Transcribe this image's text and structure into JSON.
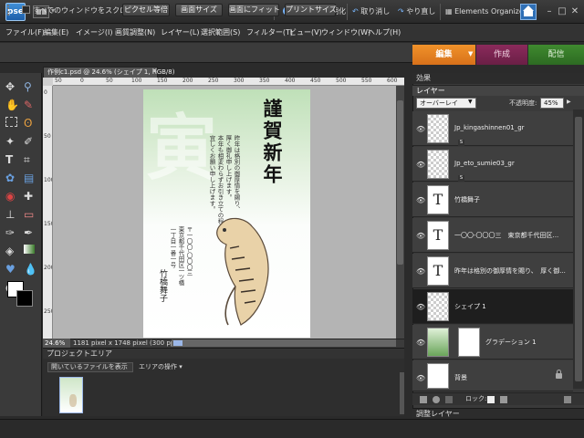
{
  "app": {
    "logo_text": "pse",
    "reset_panels": "パネルを初期化",
    "undo": "取り消し",
    "redo": "やり直し",
    "organizer": "Elements Organizer"
  },
  "menu": [
    "ファイル(F)",
    "編集(E)",
    "イメージ(I)",
    "画質調整(N)",
    "レイヤー(L)",
    "選択範囲(S)",
    "フィルター(T)",
    "ビュー(V)",
    "ウィンドウ(W)",
    "ヘルプ(H)"
  ],
  "options": {
    "scroll_all_label": "すべてのウィンドウをスクロール",
    "actual_pixels": "ピクセル等倍",
    "fit_screen": "画面サイズ",
    "fill_screen": "画面にフィット",
    "print_size": "プリントサイズ"
  },
  "mode_tabs": {
    "edit": "編集",
    "create": "作成",
    "share": "配信"
  },
  "document": {
    "tab_title": "作例c1.psd @ 24.6% (シェイプ 1, RGB/8)",
    "zoom": "24.6%",
    "status": "1181 pixel x 1748 pixel (300 pp..."
  },
  "ruler": {
    "top_ticks": [
      "50",
      "0",
      "50",
      "100",
      "150",
      "200",
      "250",
      "300",
      "350",
      "400",
      "450",
      "500",
      "550",
      "600"
    ],
    "left_ticks": [
      "0",
      "50",
      "100",
      "150",
      "200",
      "250"
    ]
  },
  "card": {
    "title": "謹賀新年",
    "ghost": "寅",
    "greeting_lines": [
      "昨年は格別の御厚情を賜り、",
      "厚く御礼申し上げます。",
      "本年も相変わらずお引き立ての程",
      "宜しくお願い申し上げます。"
    ],
    "address_lines": [
      "〒一〇〇-〇〇〇三",
      "東京都千代田区一ツ橋",
      "一丁目一番一号"
    ],
    "name": "竹橋舞子"
  },
  "project": {
    "header": "プロジェクトエリア",
    "show_select": "開いているファイルを表示",
    "area_ops": "エリアの操作"
  },
  "panel": {
    "effects_header": "効果",
    "layers_header": "レイヤー",
    "blend_mode": "オーバーレイ",
    "opacity_label": "不透明度:",
    "opacity_value": "45%",
    "lock_label": "ロック:",
    "adjust_header": "調整レイヤー"
  },
  "layers": [
    {
      "name": "Jp_kingashinnen01_gr",
      "type": "smart",
      "selected": false
    },
    {
      "name": "Jp_eto_sumie03_gr",
      "type": "smart",
      "selected": false
    },
    {
      "name": "竹橋舞子",
      "type": "text",
      "selected": false
    },
    {
      "name": "一〇〇-〇〇〇三　東京都千代田区...",
      "type": "text",
      "selected": false
    },
    {
      "name": "昨年は格別の御厚情を賜り、　厚く御...",
      "type": "text",
      "selected": false
    },
    {
      "name": "シェイプ 1",
      "type": "shape",
      "selected": true
    },
    {
      "name": "グラデーション 1",
      "type": "gradient",
      "selected": false
    },
    {
      "name": "背景",
      "type": "background",
      "selected": false
    }
  ],
  "colors": {
    "edit_tab": "#e8821f",
    "create_tab": "#7a2450",
    "share_tab": "#357a28",
    "accent": "#2f6fb5"
  }
}
